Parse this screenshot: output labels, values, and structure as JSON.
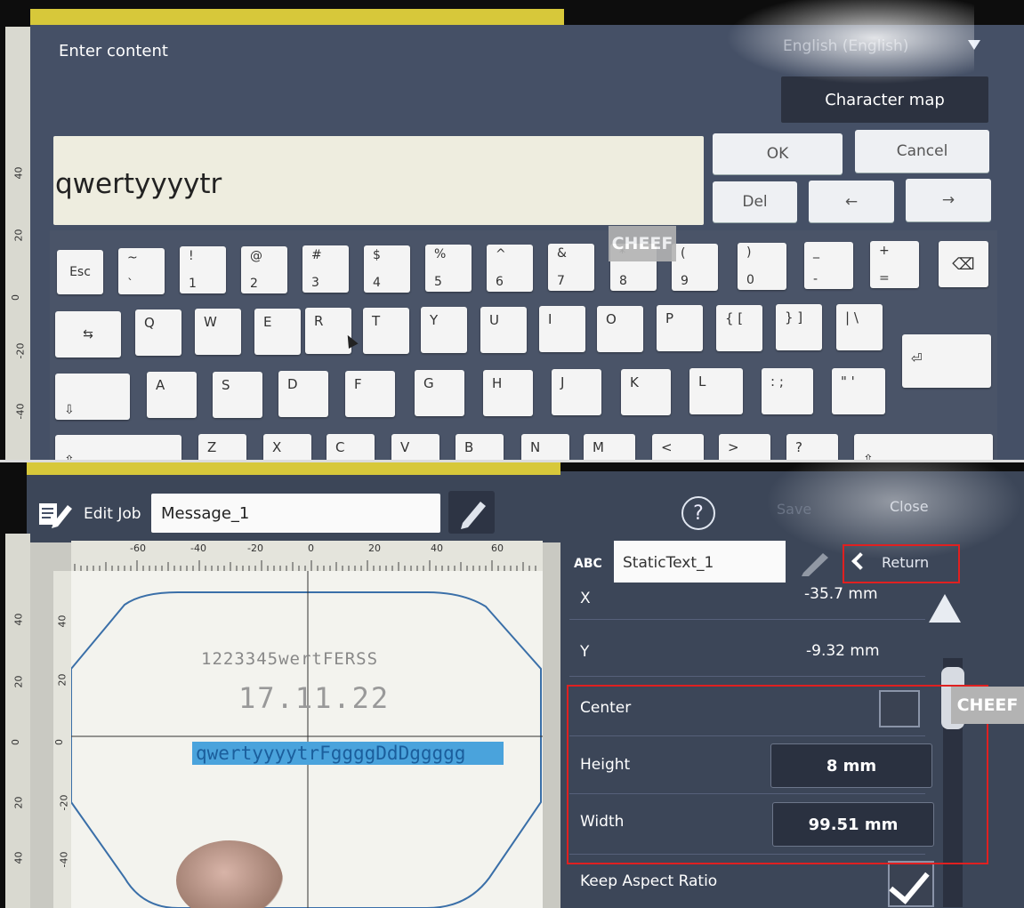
{
  "keyboard_dialog": {
    "title": "Enter content",
    "language": "English (English)",
    "character_map": "Character map",
    "input_value": "qwertyyyytr",
    "ok": "OK",
    "cancel": "Cancel",
    "del": "Del",
    "left_arrow": "←",
    "right_arrow": "→",
    "ruler_labels": [
      "40",
      "20",
      "0",
      "-20",
      "-40"
    ],
    "watermark": "CHEEF",
    "keys": {
      "row1": [
        {
          "u": "Esc",
          "l": ""
        },
        {
          "u": "~",
          "l": "`"
        },
        {
          "u": "!",
          "l": "1"
        },
        {
          "u": "@",
          "l": "2"
        },
        {
          "u": "#",
          "l": "3"
        },
        {
          "u": "$",
          "l": "4"
        },
        {
          "u": "%",
          "l": "5"
        },
        {
          "u": "^",
          "l": "6"
        },
        {
          "u": "&",
          "l": "7"
        },
        {
          "u": "*",
          "l": "8"
        },
        {
          "u": "(",
          "l": "9"
        },
        {
          "u": ")",
          "l": "0"
        },
        {
          "u": "_",
          "l": "-"
        },
        {
          "u": "+",
          "l": "="
        },
        {
          "u": "⌫",
          "l": ""
        }
      ],
      "row2": [
        "⇆",
        "Q",
        "W",
        "E",
        "R",
        "T",
        "Y",
        "U",
        "I",
        "O",
        "P",
        "{ [",
        "} ]",
        "| \\",
        "⏎"
      ],
      "row3": [
        "⇩",
        "A",
        "S",
        "D",
        "F",
        "G",
        "H",
        "J",
        "K",
        "L",
        ": ;",
        "\" '"
      ],
      "row4": [
        "⇧",
        "Z",
        "X",
        "C",
        "V",
        "B",
        "N",
        "M",
        "<",
        ">",
        "?",
        "⇧"
      ]
    }
  },
  "edit_job": {
    "title": "Edit Job",
    "job_name": "Message_1",
    "help": "?",
    "save": "Save",
    "close": "Close",
    "h_ruler": [
      "-60",
      "-40",
      "-20",
      "0",
      "20",
      "40",
      "60"
    ],
    "v_ruler": [
      "40",
      "20",
      "0",
      "-20",
      "-40"
    ],
    "left_ruler": [
      "40",
      "20",
      "0",
      "20",
      "40"
    ],
    "canvas_texts": {
      "line1": "1223345wertFERSS",
      "line2": "17.11.22",
      "line3": "qwertyyyytrFggggDdDggggg"
    },
    "object_type": "ABC",
    "object_name": "StaticText_1",
    "return": "Return",
    "properties": {
      "x_label": "X",
      "x_value": "-35.7 mm",
      "y_label": "Y",
      "y_value": "-9.32 mm",
      "center_label": "Center",
      "height_label": "Height",
      "height_value": "8 mm",
      "width_label": "Width",
      "width_value": "99.51 mm",
      "keep_aspect_label": "Keep Aspect Ratio",
      "keep_aspect_checked": true,
      "center_checked": false
    },
    "watermark": "CHEEF"
  },
  "colors": {
    "dialog_bg": "#455066",
    "highlight": "#4aa3dc",
    "annotation_red": "#e02020",
    "accent_yellow": "#d7c83a"
  }
}
